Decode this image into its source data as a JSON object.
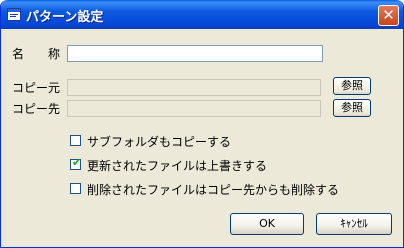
{
  "window": {
    "title": "パターン設定",
    "close_glyph": "✕",
    "accent_color": "#0054e3"
  },
  "form": {
    "name_label": "名　　称",
    "name_value": "",
    "source_label": "コピー元",
    "source_value": "",
    "dest_label": "コピー先",
    "dest_value": "",
    "browse_label": "参照"
  },
  "options": [
    {
      "label": "サブフォルダもコピーする",
      "checked": false
    },
    {
      "label": "更新されたファイルは上書きする",
      "checked": true
    },
    {
      "label": "削除されたファイルはコピー先からも削除する",
      "checked": false
    }
  ],
  "buttons": {
    "ok_label": "OK",
    "cancel_label": "ｷｬﾝｾﾙ"
  }
}
